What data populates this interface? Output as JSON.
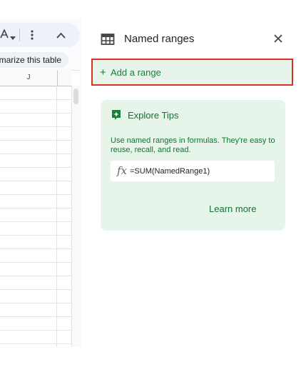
{
  "toolbar": {
    "text_color_icon": "text-color-icon",
    "more_icon": "more-vert-icon",
    "collapse_icon": "chevron-up-icon"
  },
  "summarize_chip": {
    "label": "marize this table"
  },
  "grid": {
    "column_header": "J"
  },
  "panel": {
    "icon": "table-grid-icon",
    "title": "Named ranges",
    "close_icon": "close-icon",
    "add_range": {
      "plus": "+",
      "label": "Add a range"
    },
    "tips": {
      "icon": "lightbulb-tip-icon",
      "title": "Explore Tips",
      "body": "Use named ranges in formulas. They're easy to reuse, recall, and read.",
      "formula_icon": "fx",
      "formula": "=SUM(NamedRange1)",
      "learn_more": "Learn more"
    }
  },
  "colors": {
    "accent_green": "#188038",
    "tip_text_green": "#137333",
    "tip_background": "#e6f4ea",
    "highlight_border": "#d93025"
  }
}
